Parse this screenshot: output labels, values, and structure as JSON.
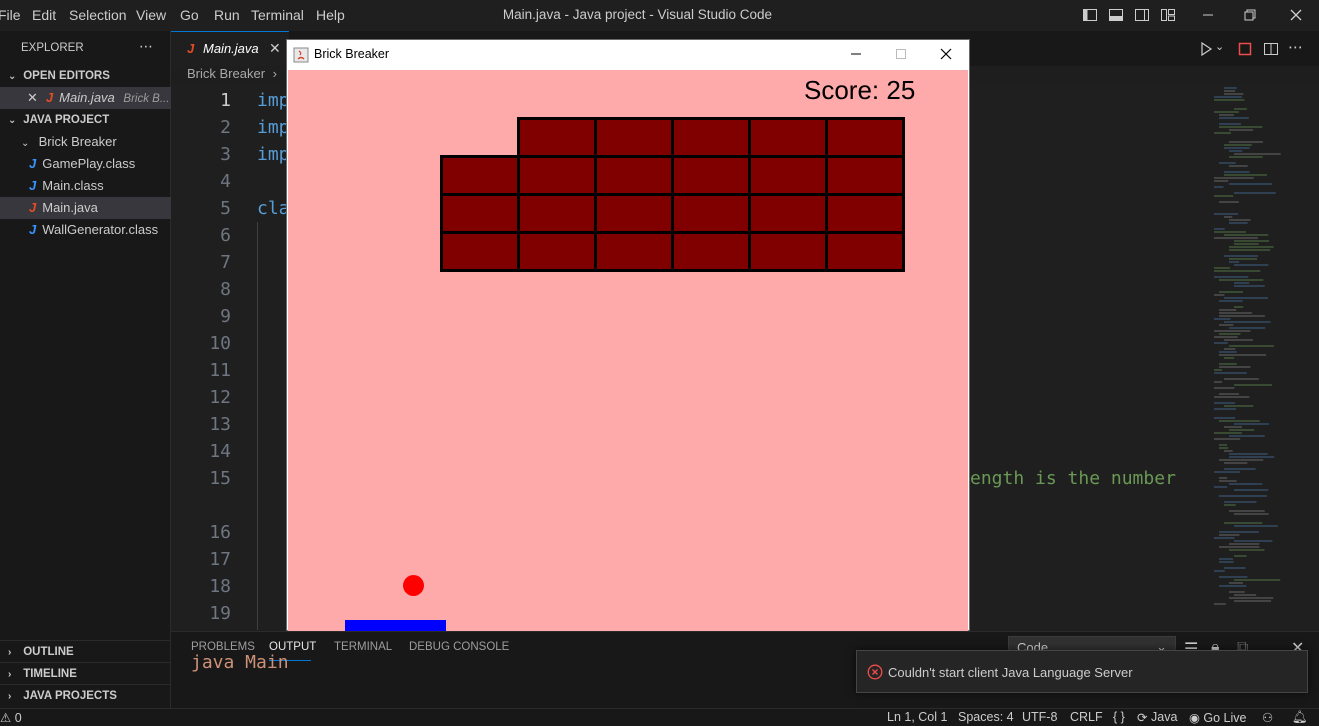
{
  "window_title": "Main.java - Java project - Visual Studio Code",
  "menu": [
    "File",
    "Edit",
    "Selection",
    "View",
    "Go",
    "Run",
    "Terminal",
    "Help"
  ],
  "sidebar": {
    "explorer_label": "EXPLORER",
    "open_editors_label": "OPEN EDITORS",
    "open_editor_file": "Main.java",
    "open_editor_folder": "Brick B...",
    "project_label": "JAVA PROJECT",
    "folder": "Brick Breaker",
    "files": [
      "GamePlay.class",
      "Main.class",
      "Main.java",
      "WallGenerator.class"
    ],
    "outline_label": "OUTLINE",
    "timeline_label": "TIMELINE",
    "java_projects_label": "JAVA PROJECTS"
  },
  "editor": {
    "tab_label": "Main.java",
    "breadcrumb": "Brick Breaker",
    "line_numbers": [
      "1",
      "2",
      "3",
      "4",
      "5",
      "6",
      "7",
      "8",
      "9",
      "10",
      "11",
      "12",
      "13",
      "14",
      "15",
      "16",
      "17",
      "18",
      "19"
    ],
    "code_imp": "imp",
    "code_cla": "cla",
    "comment_fragment": "ength is the number"
  },
  "panel": {
    "tabs": [
      "PROBLEMS",
      "OUTPUT",
      "TERMINAL",
      "DEBUG CONSOLE"
    ],
    "active_tab": "OUTPUT",
    "dropdown_value": "Code",
    "output_text": "java Main"
  },
  "notification": "Couldn't start client Java Language Server",
  "statusbar": {
    "problems": "0",
    "position": "Ln 1, Col 1",
    "spaces": "Spaces: 4",
    "encoding": "UTF-8",
    "eol": "CRLF",
    "language": "Java",
    "go_live": "Go Live"
  },
  "game_window": {
    "title": "Brick Breaker",
    "score_text": "Score: 25",
    "colors": {
      "background": "#ffaaaa",
      "brick": "#800000",
      "ball": "#ff0000",
      "paddle": "#0000ff"
    },
    "bricks_present": [
      [
        false,
        true,
        true,
        true,
        true,
        true
      ],
      [
        true,
        true,
        true,
        true,
        true,
        true
      ],
      [
        true,
        true,
        true,
        true,
        true,
        true
      ],
      [
        true,
        true,
        true,
        true,
        true,
        true
      ]
    ]
  }
}
